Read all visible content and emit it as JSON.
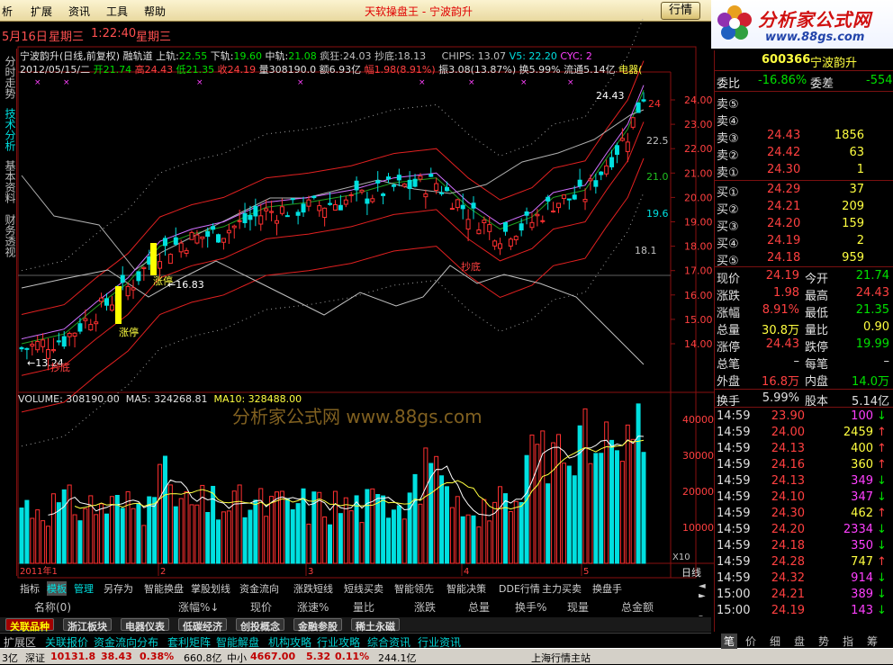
{
  "menubar": {
    "items": [
      "析",
      "扩展",
      "资讯",
      "工具",
      "帮助"
    ],
    "title": "天软操盘王 - 宁波韵升",
    "hq_button": "行情",
    "win_ctrl": "_ □ ×"
  },
  "logo": {
    "name": "分析家公式网",
    "url": "www.88gs.com"
  },
  "datebar": {
    "date": "5月16日",
    "weekday": "星期三",
    "time": "1:22:40",
    "weekday2": "星期三"
  },
  "lefttabs": [
    "分时走势",
    "技术分析",
    "基本资料",
    "财务透视"
  ],
  "chart": {
    "title": "宁波韵升(日线,前复权) 融轨道",
    "upper_label": "上轨:",
    "upper": "22.55",
    "lower_label": "下轨:",
    "lower": "19.60",
    "mid_label": "中轨:",
    "mid": "21.08",
    "crazy_label": "疯狂:",
    "crazy": "24.03",
    "bottom_label": "抄底:",
    "bottom": "18.13",
    "chips": "CHIPS: 13.07",
    "v5": "V5: 22.20",
    "cyc": "CYC: 2",
    "ohlc_date": "2012/05/15/二",
    "open": "开21.74",
    "high": "高24.43",
    "low": "低21.35",
    "close": "收24.19",
    "vol": "量308190.0",
    "amt": "额6.93亿",
    "amp": "幅1.98(8.91%)",
    "zhen": "振3.08(13.87%)",
    "turn": "换5.99%",
    "float": "流通5.14亿",
    "dianqi": "电器(",
    "price_axis": [
      "24.00",
      "23.00",
      "22.00",
      "21.00",
      "20.00",
      "19.00",
      "18.00",
      "17.00",
      "16.00",
      "15.00",
      "14.00"
    ],
    "right_labels": [
      "24",
      "22.5",
      "21.0",
      "19.6",
      "18.1"
    ],
    "annot_high": "24.43",
    "annot_low": "←13.24",
    "annot_low_red": "抄底",
    "annot_zt1": "涨停",
    "annot_zt2": "涨停",
    "annot_dp": "跌停",
    "annot_price": "←16.83",
    "annot_hd": "抄底"
  },
  "volume": {
    "label": "VOLUME: 308190.00",
    "ma5": "MA5: 324268.81",
    "ma10": "MA10: 328488.00",
    "axis": [
      "40000",
      "30000",
      "20000",
      "10000"
    ],
    "unit": "X10",
    "watermark": "分析家公式网 www.88gs.com",
    "xaxis": [
      "2011年1",
      "2",
      "3",
      "4",
      "5"
    ],
    "period": "日线"
  },
  "chart_data": {
    "type": "bar",
    "title": "VOLUME",
    "ylim": [
      0,
      45000
    ],
    "ma5": 324268.81,
    "ma10": 328488.0,
    "last": 30819
  },
  "bottomtabs": [
    "指标",
    "模板",
    "管理",
    "另存为",
    "智能换盘",
    "掌股划线",
    "资金流向",
    "涨跌短线",
    "短线买卖",
    "智能领先",
    "智能决策",
    "DDE行情",
    "主力买卖",
    "换盘手"
  ],
  "colhdr": [
    "名称(0)",
    "涨幅%↓",
    "现价",
    "涨速%",
    "量比",
    "涨跌",
    "总量",
    "换手%",
    "现量",
    "总金额"
  ],
  "sectors": [
    "关联品种",
    "浙江板块",
    "电器仪表",
    "低碳经济",
    "创投概念",
    "金融参股",
    "稀土永磁"
  ],
  "infobar": [
    "扩展区",
    "关联报价",
    "资金流向分布",
    "套利矩阵",
    "智能解盘",
    "机构攻略",
    "行业攻略",
    "综合资讯",
    "行业资讯"
  ],
  "statusbar": {
    "a": "3亿",
    "b": "深证",
    "b_val": "10131.8",
    "b_chg": "38.43",
    "b_pct": "0.38%",
    "b_amt": "660.8亿",
    "c": "中小",
    "c_val": "4667.00",
    "c_chg": "5.32",
    "c_pct": "0.11%",
    "c_amt": "244.1亿",
    "d": "上海行情主站"
  },
  "quote": {
    "code": "600366",
    "name": "宁波韵升",
    "weibi_label": "委比",
    "weibi": "-16.86%",
    "weicha_label": "委差",
    "weicha": "-554",
    "sell": [
      {
        "l": "卖⑤",
        "p": "",
        "v": ""
      },
      {
        "l": "卖④",
        "p": "",
        "v": ""
      },
      {
        "l": "卖③",
        "p": "24.43",
        "v": "1856"
      },
      {
        "l": "卖②",
        "p": "24.42",
        "v": "63"
      },
      {
        "l": "卖①",
        "p": "24.30",
        "v": "1"
      }
    ],
    "buy": [
      {
        "l": "买①",
        "p": "24.29",
        "v": "37"
      },
      {
        "l": "买②",
        "p": "24.21",
        "v": "209"
      },
      {
        "l": "买③",
        "p": "24.20",
        "v": "159"
      },
      {
        "l": "买④",
        "p": "24.19",
        "v": "2"
      },
      {
        "l": "买⑤",
        "p": "24.18",
        "v": "959"
      }
    ],
    "stats": [
      {
        "a": "现价",
        "av": "24.19",
        "b": "今开",
        "bv": "21.74"
      },
      {
        "a": "涨跌",
        "av": "1.98",
        "b": "最高",
        "bv": "24.43"
      },
      {
        "a": "涨幅",
        "av": "8.91%",
        "b": "最低",
        "bv": "21.35"
      },
      {
        "a": "总量",
        "av": "30.8万",
        "b": "量比",
        "bv": "0.90"
      },
      {
        "a": "涨停",
        "av": "24.43",
        "b": "跌停",
        "bv": "19.99"
      },
      {
        "a": "总笔",
        "av": "–",
        "b": "每笔",
        "bv": "–"
      },
      {
        "a": "外盘",
        "av": "16.8万",
        "b": "内盘",
        "bv": "14.0万"
      }
    ],
    "turn_label": "换手",
    "turn": "5.99%",
    "cap_label": "股本",
    "cap": "5.14亿",
    "ticks": [
      {
        "t": "14:59",
        "p": "23.90",
        "v": "100",
        "s": "S"
      },
      {
        "t": "14:59",
        "p": "24.00",
        "v": "2459",
        "s": "B"
      },
      {
        "t": "14:59",
        "p": "24.13",
        "v": "400",
        "s": "B"
      },
      {
        "t": "14:59",
        "p": "24.16",
        "v": "360",
        "s": "B"
      },
      {
        "t": "14:59",
        "p": "24.13",
        "v": "349",
        "s": "S"
      },
      {
        "t": "14:59",
        "p": "24.10",
        "v": "347",
        "s": "S"
      },
      {
        "t": "14:59",
        "p": "24.30",
        "v": "462",
        "s": "B"
      },
      {
        "t": "14:59",
        "p": "24.20",
        "v": "2334",
        "s": "S"
      },
      {
        "t": "14:59",
        "p": "24.18",
        "v": "350",
        "s": "S"
      },
      {
        "t": "14:59",
        "p": "24.28",
        "v": "747",
        "s": "B"
      },
      {
        "t": "14:59",
        "p": "24.32",
        "v": "914",
        "s": "S"
      },
      {
        "t": "15:00",
        "p": "24.21",
        "v": "389",
        "s": "S"
      },
      {
        "t": "15:00",
        "p": "24.19",
        "v": "143",
        "s": "S"
      }
    ],
    "rtabs": [
      "笔",
      "价",
      "细",
      "盘",
      "势",
      "指",
      "筹"
    ]
  }
}
